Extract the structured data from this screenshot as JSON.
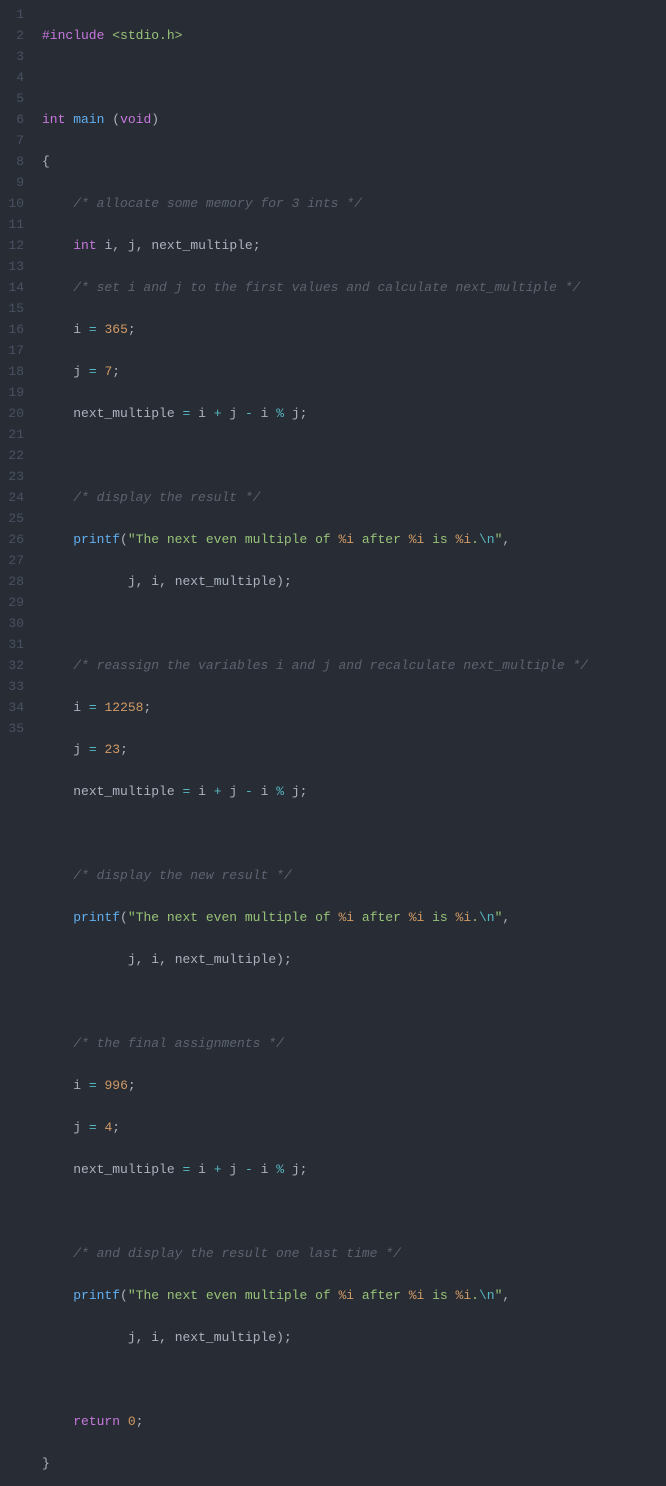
{
  "line_count": 35,
  "tokens": {
    "include": "#include",
    "stdio": "<stdio.h>",
    "int": "int",
    "void": "void",
    "return": "return",
    "main": "main",
    "printf": "printf",
    "i": "i",
    "j": "j",
    "nm": "next_multiple",
    "n365": "365",
    "n7": "7",
    "n12258": "12258",
    "n23": "23",
    "n996": "996",
    "n4": "4",
    "n0": "0",
    "eq": "=",
    "plus": "+",
    "minus": "-",
    "mod": "%",
    "semi": ";",
    "comma": ",",
    "lparen": "(",
    "rparen": ")",
    "lbrace": "{",
    "rbrace": "}",
    "sp": " ",
    "cmt_alloc": "/* allocate some memory for 3 ints */",
    "cmt_set": "/* set i and j to the first values and calculate next_multiple */",
    "cmt_disp1": "/* display the result */",
    "cmt_reassign": "/* reassign the variables i and j and recalculate next_multiple */",
    "cmt_disp2": "/* display the new result */",
    "cmt_final": "/* the final assignments */",
    "cmt_last": "/* and display the result one last time */",
    "str_start": "\"The next even multiple of ",
    "str_mid1": " after ",
    "str_mid2": " is ",
    "str_dot": ".",
    "str_end": "\"",
    "fmt_i": "%i",
    "esc_n": "\\n"
  }
}
